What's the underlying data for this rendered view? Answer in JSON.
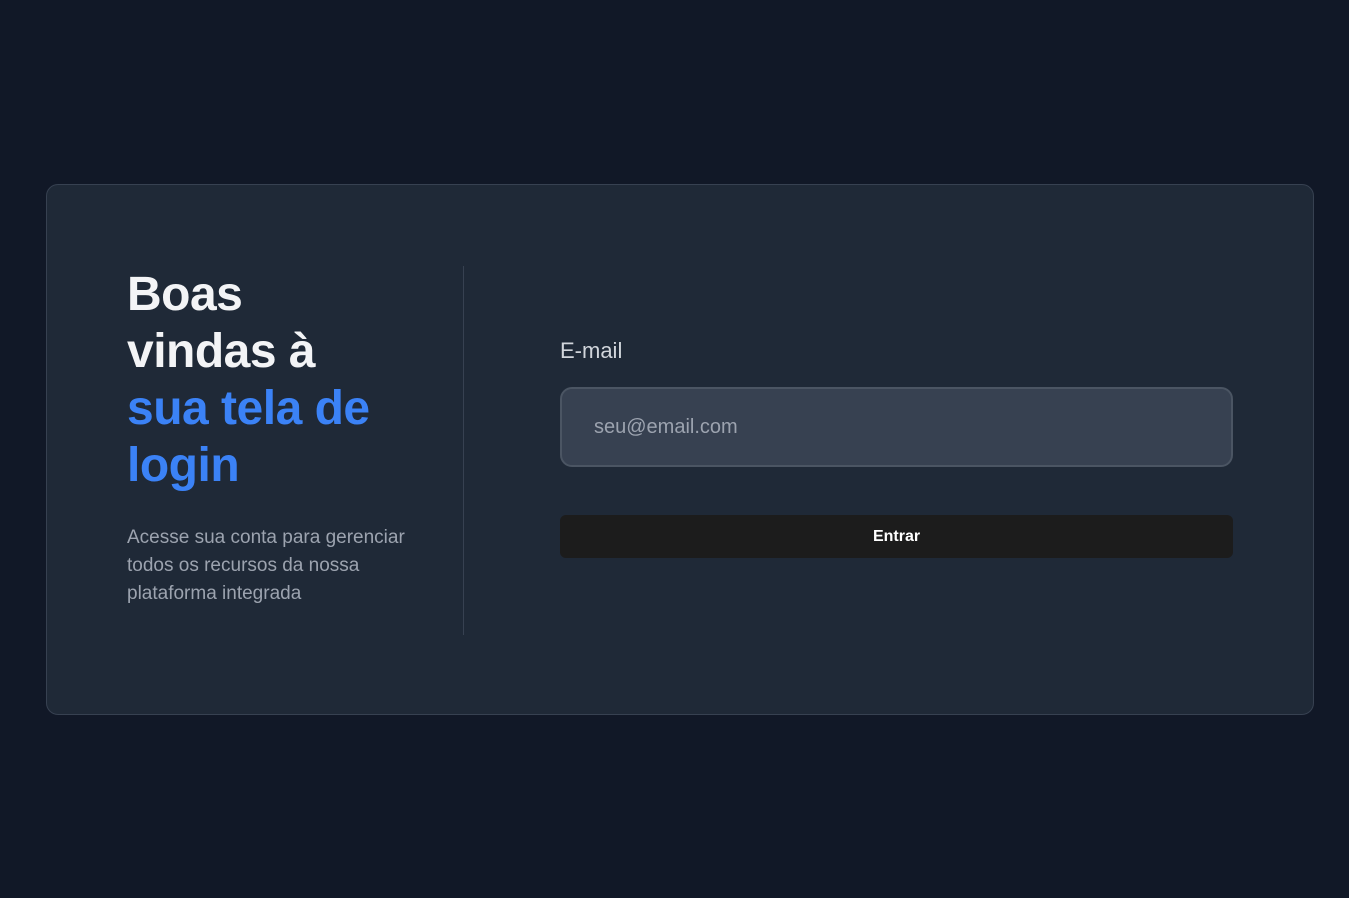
{
  "welcome": {
    "headline_line1": "Boas",
    "headline_line2": "vindas à",
    "headline_highlight_line1": "sua tela de",
    "headline_highlight_line2": "login",
    "subtitle": "Acesse sua conta para gerenciar todos os recursos da nossa plataforma integrada"
  },
  "form": {
    "email_label": "E-mail",
    "email_placeholder": "seu@email.com",
    "email_value": "",
    "submit_label": "Entrar"
  },
  "colors": {
    "page_background": "#111827",
    "card_background": "#1f2937",
    "accent": "#3b82f6",
    "button_background": "#1c1c1c"
  }
}
